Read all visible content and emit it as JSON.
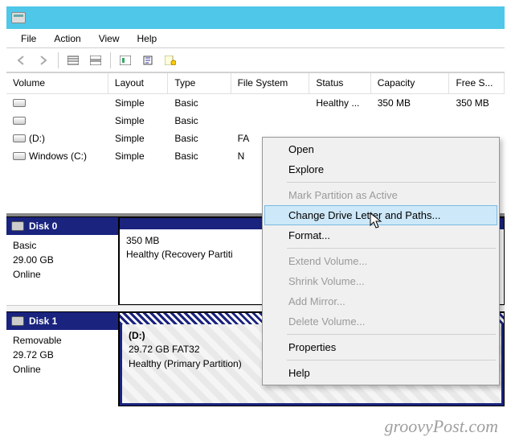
{
  "menubar": {
    "file": "File",
    "action": "Action",
    "view": "View",
    "help": "Help"
  },
  "columns": {
    "volume": "Volume",
    "layout": "Layout",
    "type": "Type",
    "fs": "File System",
    "status": "Status",
    "capacity": "Capacity",
    "free": "Free S..."
  },
  "volumes": [
    {
      "name": "",
      "layout": "Simple",
      "type": "Basic",
      "fs": "",
      "status": "Healthy ...",
      "capacity": "350 MB",
      "free": "350 MB"
    },
    {
      "name": "",
      "layout": "Simple",
      "type": "Basic",
      "fs": "",
      "status": "",
      "capacity": "",
      "free": ""
    },
    {
      "name": "(D:)",
      "layout": "Simple",
      "type": "Basic",
      "fs": "FA",
      "status": "",
      "capacity": "",
      "free": ""
    },
    {
      "name": "Windows (C:)",
      "layout": "Simple",
      "type": "Basic",
      "fs": "N",
      "status": "",
      "capacity": "",
      "free": ""
    }
  ],
  "disks": [
    {
      "header": "Disk 0",
      "type": "Basic",
      "size": "29.00 GB",
      "status": "Online",
      "vol": {
        "line1": "",
        "line2": "350 MB",
        "line3": "Healthy (Recovery Partiti"
      }
    },
    {
      "header": "Disk 1",
      "type": "Removable",
      "size": "29.72 GB",
      "status": "Online",
      "vol": {
        "line1": "(D:)",
        "line2": "29.72 GB FAT32",
        "line3": "Healthy (Primary Partition)"
      }
    }
  ],
  "context_menu": {
    "open": "Open",
    "explore": "Explore",
    "mark": "Mark Partition as Active",
    "change": "Change Drive Letter and Paths...",
    "format": "Format...",
    "extend": "Extend Volume...",
    "shrink": "Shrink Volume...",
    "mirror": "Add Mirror...",
    "delete": "Delete Volume...",
    "props": "Properties",
    "help": "Help"
  },
  "watermark": "groovyPost.com"
}
